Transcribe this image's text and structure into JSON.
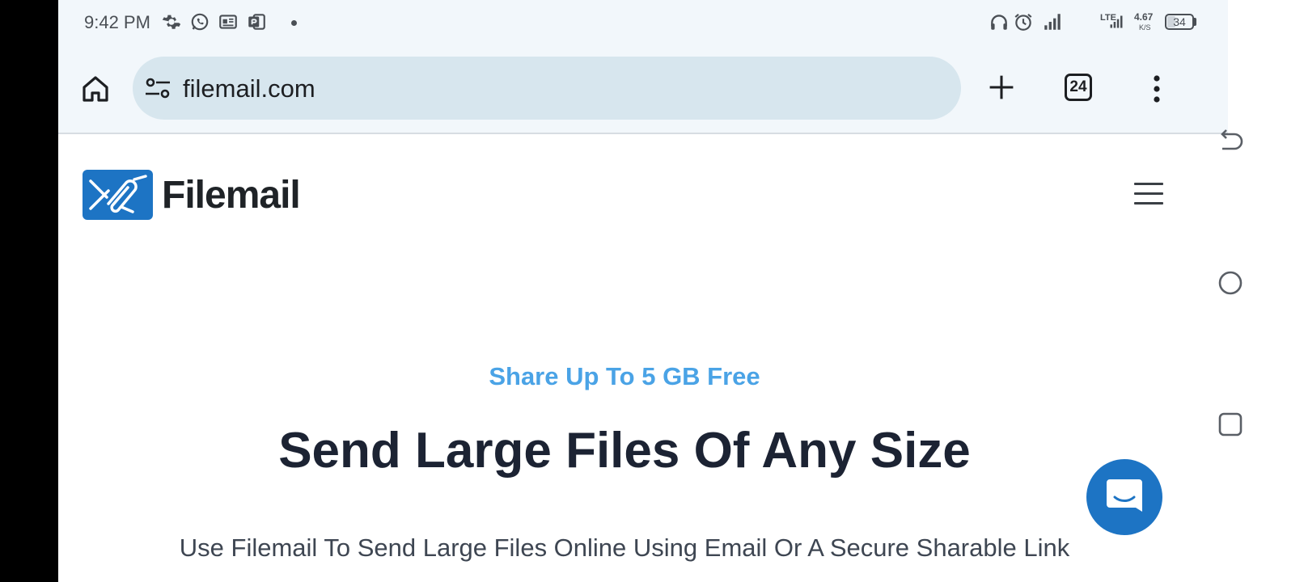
{
  "status_bar": {
    "time": "9:42 PM",
    "network_type": "LTE",
    "speed_value": "4.67",
    "speed_unit": "K/S",
    "battery_level": "34",
    "icons": [
      "settings-icon",
      "whatsapp-icon",
      "news-icon",
      "powerpoint-icon",
      "headphones-icon",
      "alarm-icon",
      "signal-icon"
    ]
  },
  "browser": {
    "url": "filemail.com",
    "tab_count": "24"
  },
  "site": {
    "brand_name": "Filemail",
    "hero": {
      "eyebrow": "Share Up To 5 GB Free",
      "title": "Send Large Files Of Any Size",
      "subtitle": "Use Filemail To Send Large Files Online Using Email Or A Secure Sharable Link"
    }
  },
  "colors": {
    "brand_blue": "#1d74c4",
    "eyebrow_blue": "#4aa3e6",
    "title_navy": "#1c2333",
    "toolbar_bg": "#f2f7fb",
    "url_bar_bg": "#d7e6ee"
  }
}
